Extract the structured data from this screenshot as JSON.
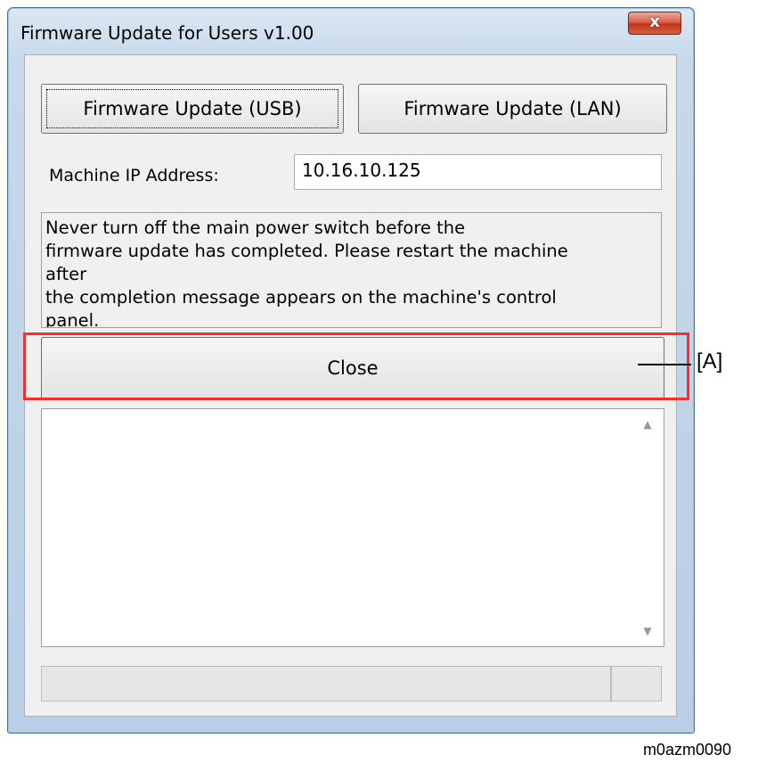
{
  "window": {
    "title": "Firmware Update for Users v1.00",
    "close_glyph": "x"
  },
  "buttons": {
    "usb": "Firmware Update (USB)",
    "lan": "Firmware Update (LAN)",
    "close": "Close"
  },
  "ip": {
    "label": "Machine IP Address:",
    "value": "10.16.10.125"
  },
  "message_lines": [
    "Never turn off the main power switch before the",
    "firmware update has completed. Please restart the machine",
    "after",
    "the completion message appears on the machine's control",
    "panel."
  ],
  "log": {
    "content": ""
  },
  "annotation": {
    "callout": "[A]",
    "figure_id": "m0azm0090"
  },
  "colors": {
    "highlight": "#ff2a2a",
    "title_close_button": "#c2361f"
  }
}
